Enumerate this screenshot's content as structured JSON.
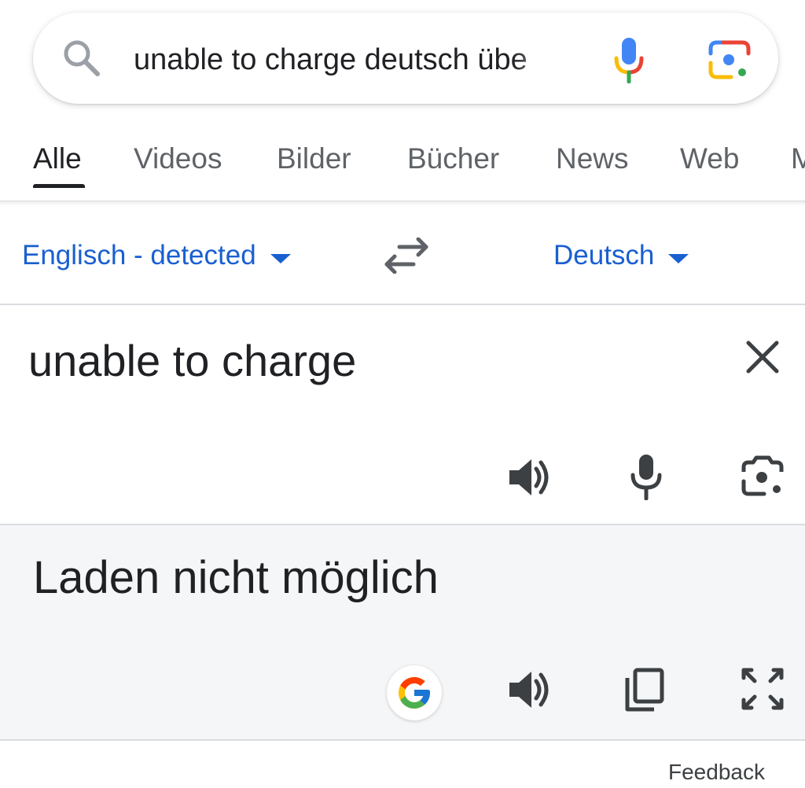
{
  "search": {
    "query": "unable to charge deutsch übe",
    "icons": [
      "search-icon",
      "mic-icon",
      "lens-icon"
    ]
  },
  "tabs": [
    {
      "label": "Alle",
      "active": true
    },
    {
      "label": "Videos",
      "active": false
    },
    {
      "label": "Bilder",
      "active": false
    },
    {
      "label": "Bücher",
      "active": false
    },
    {
      "label": "News",
      "active": false
    },
    {
      "label": "Web",
      "active": false
    },
    {
      "label": "M",
      "active": false
    }
  ],
  "translator": {
    "source_language": "Englisch - detected",
    "target_language": "Deutsch",
    "source_text": "unable to charge",
    "target_text": "Laden nicht möglich",
    "icons": {
      "swap": "swap-arrows-icon",
      "clear": "close-icon",
      "source_speak": "speaker-icon",
      "source_mic": "mic-icon",
      "source_camera": "camera-icon",
      "google": "google-logo-icon",
      "target_speak": "speaker-icon",
      "copy": "copy-icon",
      "expand": "fullscreen-icon"
    }
  },
  "footer": {
    "feedback_label": "Feedback"
  },
  "colors": {
    "link_blue": "#1a5fd0",
    "text": "#202124",
    "muted": "#5f6368",
    "target_bg": "#f5f6f7",
    "divider": "#dadce0"
  }
}
